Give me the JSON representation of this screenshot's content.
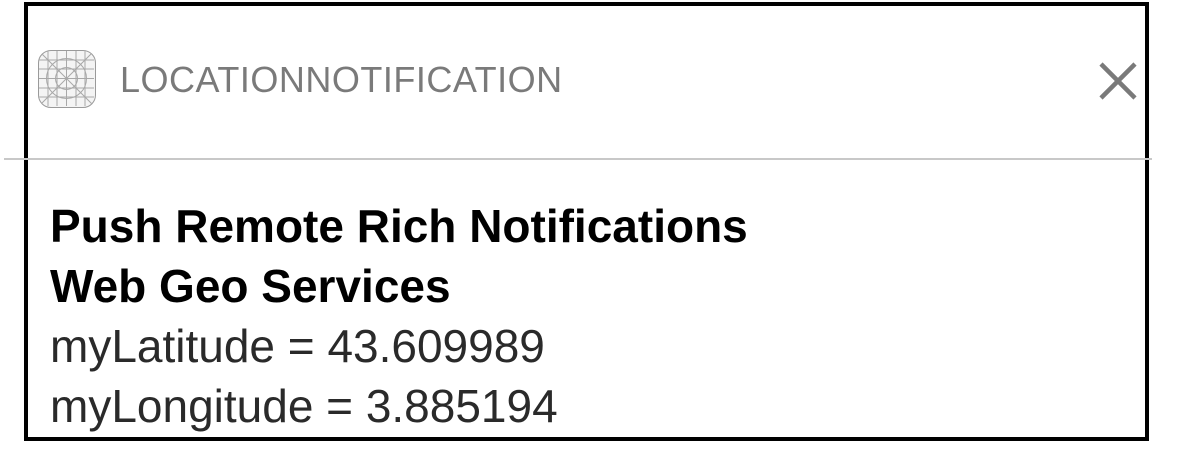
{
  "notification": {
    "app_name": "LOCATIONNOTIFICATION",
    "app_icon": "app-grid-icon",
    "close_icon": "close-icon",
    "title": "Push Remote Rich Notifications",
    "subtitle": "Web Geo Services",
    "lines": [
      "myLatitude = 43.609989",
      "myLongitude = 3.885194"
    ]
  },
  "colors": {
    "border": "#000000",
    "app_name_text": "#7a7a7a",
    "close_icon": "#7a7a7a",
    "title_text": "#000000",
    "message_text": "#2a2a2a",
    "divider": "#c8c8c8"
  }
}
